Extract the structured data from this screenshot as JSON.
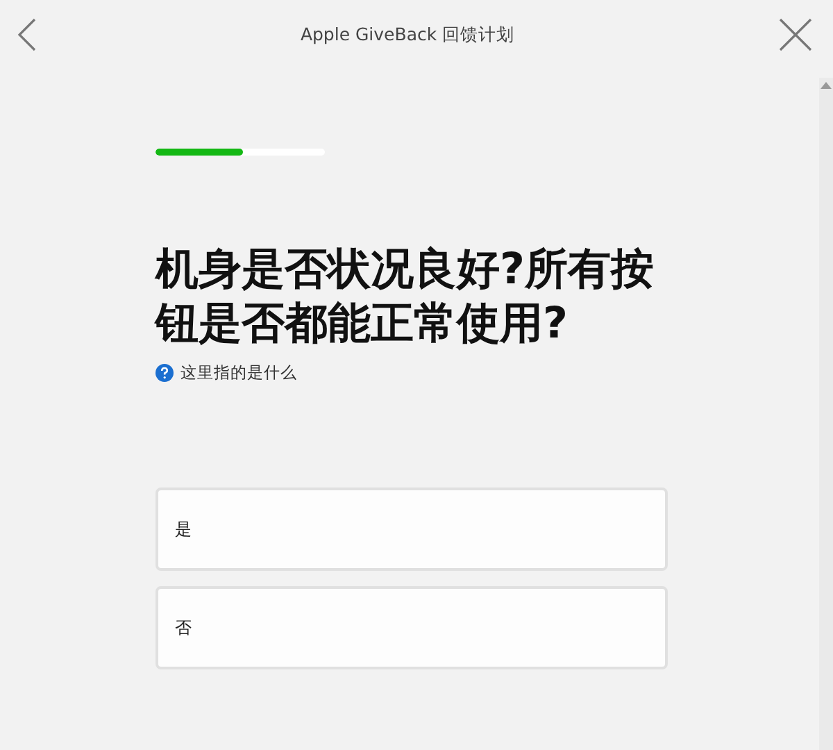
{
  "header": {
    "title": "Apple GiveBack 回馈计划"
  },
  "progress": {
    "level": 0.52
  },
  "question": "机身是否状况良好?所有按钮是否都能正常使用?",
  "help_link": "这里指的是什么",
  "options": [
    {
      "label": "是"
    },
    {
      "label": "否"
    }
  ]
}
